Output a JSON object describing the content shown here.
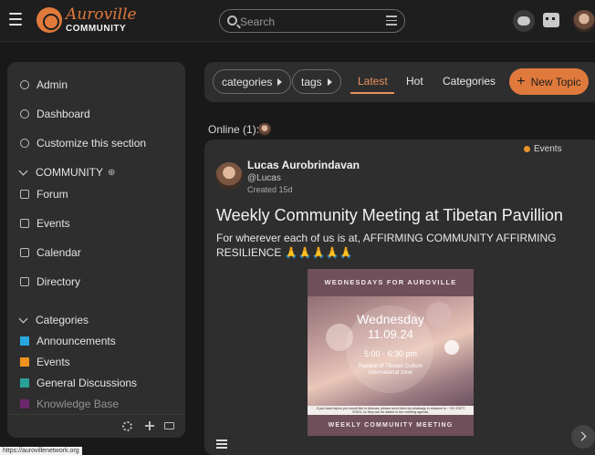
{
  "header": {
    "logo_top": "Auroville",
    "logo_bottom": "COMMUNITY",
    "search_placeholder": "Search"
  },
  "sidebar": {
    "items": [
      {
        "label": "Admin",
        "icon": "wrench-icon"
      },
      {
        "label": "Dashboard",
        "icon": "anchor-icon"
      },
      {
        "label": "Customize this section",
        "icon": "pencil-icon"
      }
    ],
    "community_heading": "COMMUNITY",
    "community_items": [
      {
        "label": "Forum",
        "icon": "forum-icon"
      },
      {
        "label": "Events",
        "icon": "calendar-icon"
      },
      {
        "label": "Calendar",
        "icon": "calendar-icon"
      },
      {
        "label": "Directory",
        "icon": "address-book-icon"
      }
    ],
    "categories_heading": "Categories",
    "categories": [
      {
        "label": "Announcements",
        "color": "#29a8e0"
      },
      {
        "label": "Events",
        "color": "#f0921f"
      },
      {
        "label": "General Discussions",
        "color": "#2aa198"
      },
      {
        "label": "Knowledge Base",
        "color": "#a020a0"
      }
    ]
  },
  "nav": {
    "categories_pill": "categories",
    "tags_pill": "tags",
    "tabs": [
      "Latest",
      "Hot",
      "Categories"
    ],
    "active_tab": "Latest",
    "new_topic": "New Topic"
  },
  "online": {
    "label": "Online (1):"
  },
  "post": {
    "category": "Events",
    "author_name": "Lucas Aurobrindavan",
    "author_handle": "@Lucas",
    "created": "Created 15d",
    "title": "Weekly Community Meeting at Tibetan Pavillion",
    "body": "For wherever each of us is at, AFFIRMING COMMUNITY AFFIRMING RESILIENCE",
    "emoji": "🙏🙏🙏🙏🙏",
    "poster": {
      "top": "WEDNESDAYS FOR AUROVILLE",
      "day": "Wednesday",
      "date": "11.09.24",
      "time": "5:00 - 6:30 pm",
      "venue_line1": "Pavilion of Tibetan Culture",
      "venue_line2": "International zone",
      "note": "If you have topics you would like to discuss, please send them by whatsapp in advance to : +91 97877 97824, so they can be added to the meeting agenda.",
      "bottom": "WEEKLY COMMUNITY MEETING"
    }
  },
  "status_url": "https://aurovillenetwork.org"
}
